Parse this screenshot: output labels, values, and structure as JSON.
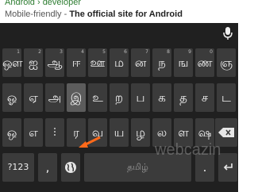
{
  "search_result": {
    "url": "Android › developer",
    "snippet_prefix": "Mobile-friendly - ",
    "snippet_title": "The official site for Android"
  },
  "keyboard": {
    "row1": [
      {
        "label": "ஔ",
        "hint": "1"
      },
      {
        "label": "ஐ",
        "hint": "2"
      },
      {
        "label": "ஆ",
        "hint": "3"
      },
      {
        "label": "ஈ",
        "hint": "4"
      },
      {
        "label": "ஊ",
        "hint": "5"
      },
      {
        "label": "ம",
        "hint": "6"
      },
      {
        "label": "ன",
        "hint": "7"
      },
      {
        "label": "ந",
        "hint": "8"
      },
      {
        "label": "ங",
        "hint": "9"
      },
      {
        "label": "ண",
        "hint": "0"
      },
      {
        "label": "ஞ",
        "hint": ""
      }
    ],
    "row2": [
      {
        "label": "ஓ"
      },
      {
        "label": "ஏ"
      },
      {
        "label": "அ"
      },
      {
        "label": "இ",
        "selected": true
      },
      {
        "label": "உ"
      },
      {
        "label": "ற"
      },
      {
        "label": "ப"
      },
      {
        "label": "க"
      },
      {
        "label": "த"
      },
      {
        "label": "ச"
      },
      {
        "label": "ட"
      }
    ],
    "row3": [
      {
        "label": "ஒ"
      },
      {
        "label": "எ"
      },
      {
        "label": ""
      },
      {
        "label": "ர"
      },
      {
        "label": "வ"
      },
      {
        "label": "ய"
      },
      {
        "label": "ழ"
      },
      {
        "label": "ல"
      },
      {
        "label": "ள"
      },
      {
        "label": "ஷ"
      }
    ],
    "bottom": {
      "symbols_label": "?123",
      "comma_label": ",",
      "space_label": "தமிழ்",
      "period_label": "."
    }
  },
  "watermark": "webcazin",
  "colors": {
    "keyboard_bg": "#202020",
    "key_bg": "#3b3b3b",
    "arrow": "#ff6a1a",
    "url_green": "#2e7d32"
  },
  "icons": [
    "microphone-icon",
    "globe-icon",
    "backspace-icon",
    "orange-arrow-annotation"
  ]
}
